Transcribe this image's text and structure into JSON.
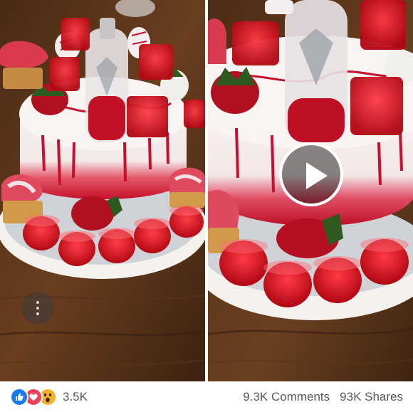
{
  "reactions": {
    "icons": [
      "like-icon",
      "love-icon",
      "wow-icon"
    ],
    "count": "3.5K"
  },
  "stats": {
    "comments": "9.3K Comments",
    "shares": "93K Shares"
  },
  "colors": {
    "like": "#1877f2",
    "love": "#f33e58",
    "wow": "#f7b125",
    "text": "#555a61"
  }
}
